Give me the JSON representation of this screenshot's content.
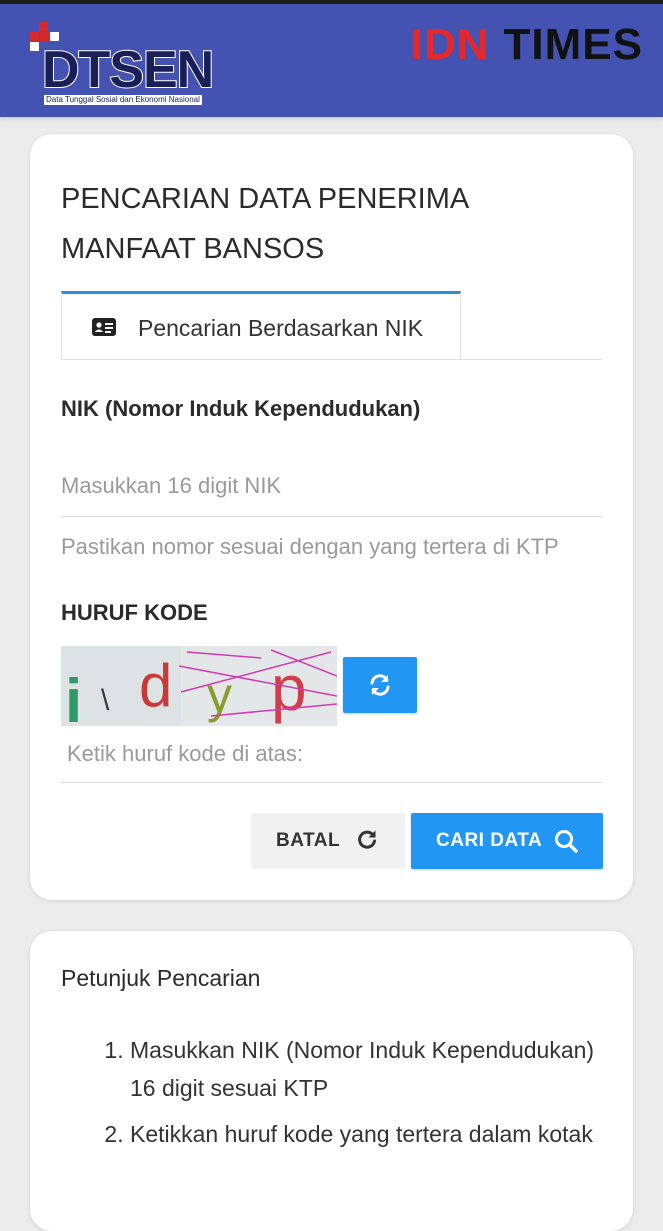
{
  "header": {
    "logo_text": "DTSEN",
    "logo_tagline": "Data Tunggal Sosial dan Ekonomi Nasional",
    "brand_primary": "IDN",
    "brand_secondary": "TIMES",
    "colors": {
      "header_bg": "#4452b1",
      "brand_red": "#e6282d",
      "logo_square_red": "#d42a2e"
    }
  },
  "search_card": {
    "title": "PENCARIAN DATA PENERIMA MANFAAT BANSOS",
    "tab": {
      "label": "Pencarian Berdasarkan NIK",
      "icon": "id-card-icon"
    },
    "nik": {
      "label": "NIK (Nomor Induk Kependudukan)",
      "placeholder": "Masukkan 16 digit NIK",
      "value": "",
      "hint": "Pastikan nomor sesuai dengan yang tertera di KTP"
    },
    "captcha": {
      "label": "HURUF KODE",
      "characters": [
        "i",
        "\\",
        "d",
        "y",
        "p"
      ],
      "refresh_icon": "refresh-icon",
      "input_placeholder": "Ketik huruf kode di atas:",
      "input_value": ""
    },
    "buttons": {
      "cancel_label": "BATAL",
      "cancel_icon": "reset-icon",
      "search_label": "CARI DATA",
      "search_icon": "search-icon"
    },
    "colors": {
      "accent": "#2196f3",
      "tab_border": "#2d8fd8"
    }
  },
  "help_card": {
    "title": "Petunjuk Pencarian",
    "steps": [
      "Masukkan NIK (Nomor Induk Kependudukan) 16 digit sesuai KTP",
      "Ketikkan huruf kode yang tertera dalam kotak"
    ]
  }
}
